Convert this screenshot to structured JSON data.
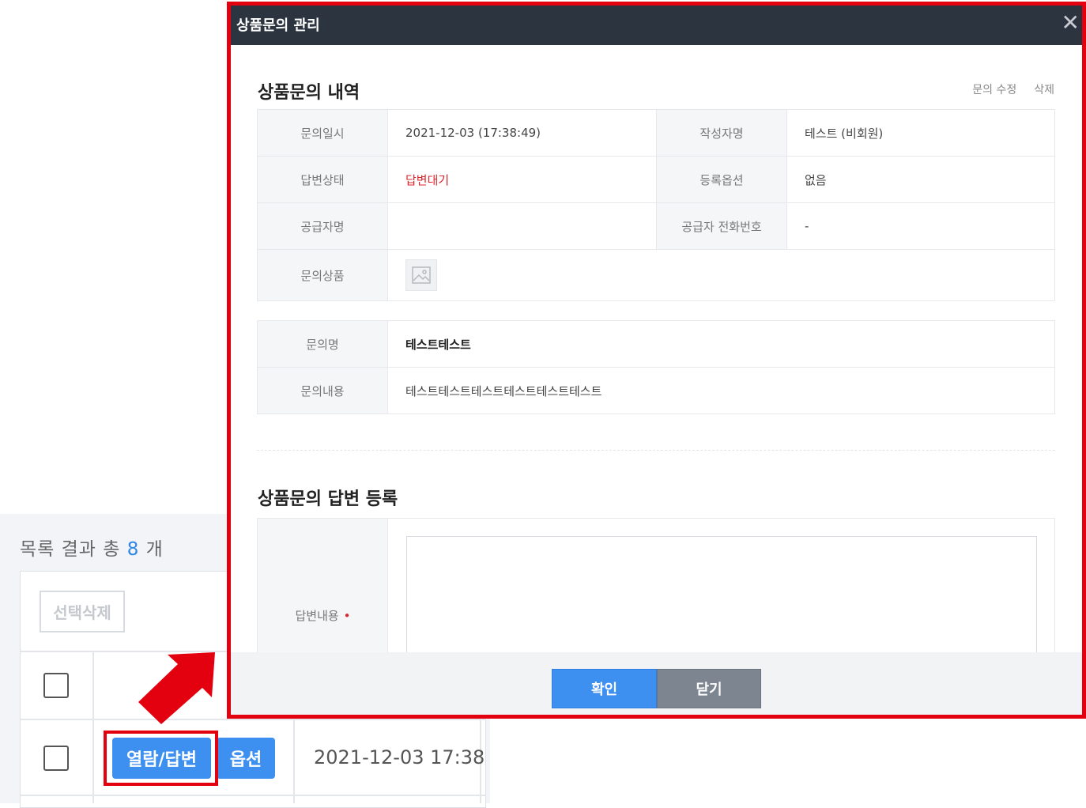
{
  "list_page": {
    "result_prefix": "목록 결과 총 ",
    "result_count": "8",
    "result_suffix": " 개",
    "select_delete_label": "선택삭제",
    "row": {
      "view_answer_label": "열람/답변",
      "option_label": "옵션",
      "date": "2021-12-03 17:38"
    }
  },
  "modal": {
    "title": "상품문의 관리",
    "close_glyph": "✕",
    "history_title": "상품문의 내역",
    "edit_link": "문의 수정",
    "delete_link": "삭제",
    "info": {
      "inquiry_date_label": "문의일시",
      "inquiry_date": "2021-12-03 (17:38:49)",
      "author_label": "작성자명",
      "author": "테스트 (비회원)",
      "answer_status_label": "답변상태",
      "answer_status": "답변대기",
      "option_label": "등록옵션",
      "option": "없음",
      "supplier_label": "공급자명",
      "supplier": "",
      "supplier_phone_label": "공급자 전화번호",
      "supplier_phone": "-",
      "product_label": "문의상품"
    },
    "content": {
      "subject_label": "문의명",
      "subject": "테스트테스트",
      "body_label": "문의내용",
      "body": "테스트테스트테스트테스트테스트테스트"
    },
    "answer_title": "상품문의 답변 등록",
    "answer_label": "답변내용",
    "required_mark": "•",
    "answer_value": "",
    "confirm_label": "확인",
    "close_label": "닫기"
  },
  "colors": {
    "accent": "#3d8ff0",
    "header": "#2c3440",
    "highlight": "#e3000f",
    "status_red": "#d9262c"
  },
  "icons": [
    "close-icon",
    "image-placeholder-icon",
    "arrow-annotation-icon"
  ]
}
